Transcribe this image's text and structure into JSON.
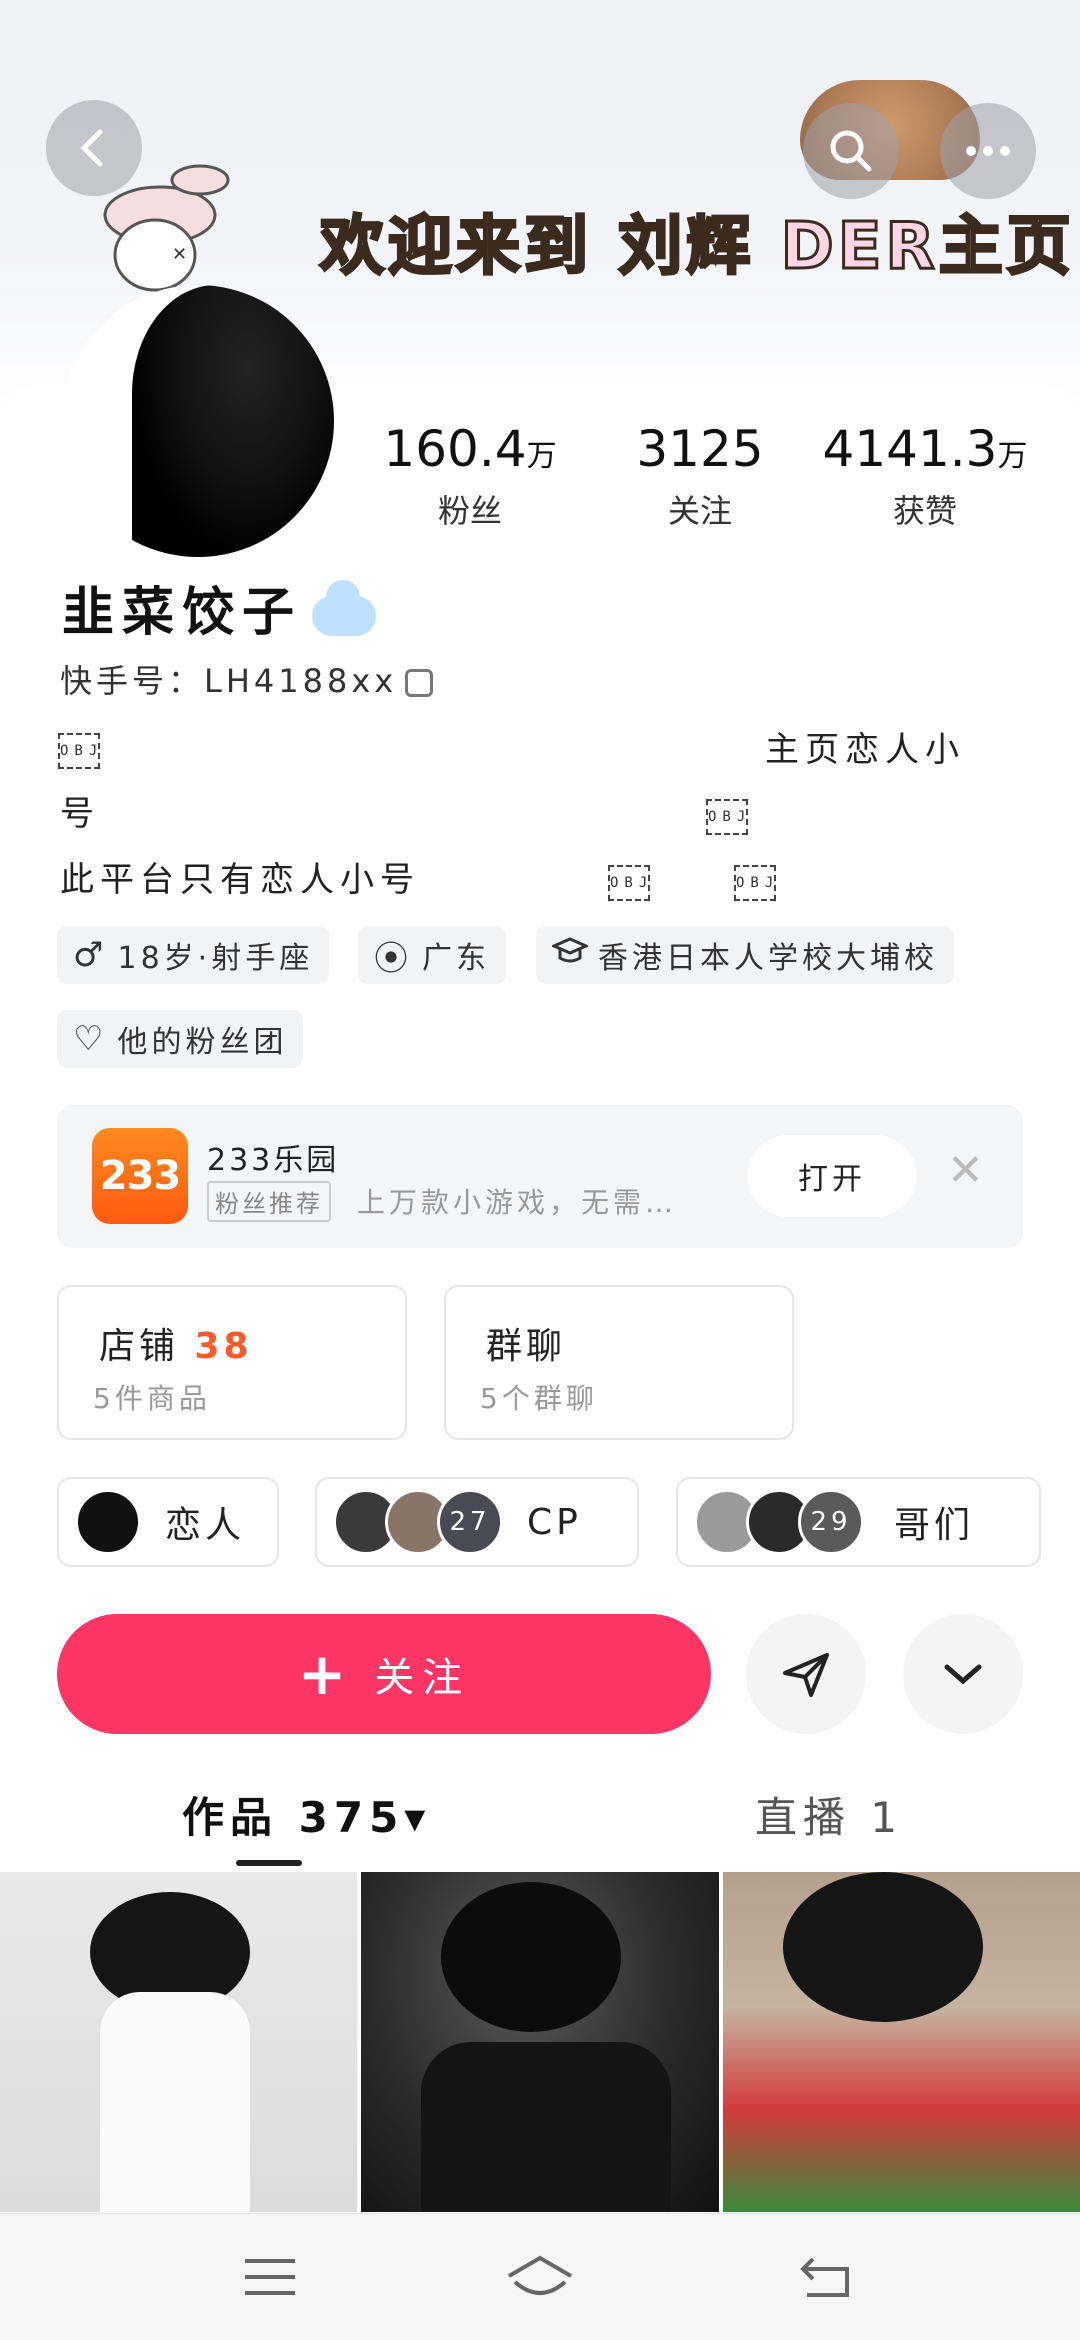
{
  "header": {
    "banner_prefix": "欢迎来到",
    "banner_name": "刘辉",
    "banner_der": "DER",
    "banner_suffix": "主页"
  },
  "profile": {
    "nickname": "韭菜饺子",
    "kuaishou_id": "快手号：LH4188xx",
    "stats": [
      {
        "value": "160.4",
        "unit": "万",
        "label": "粉丝"
      },
      {
        "value": "3125",
        "unit": "",
        "label": "关注"
      },
      {
        "value": "4141.3",
        "unit": "万",
        "label": "获赞"
      }
    ],
    "bio": {
      "line1_right": "主页恋人小",
      "line2": "号",
      "line3": "此平台只有恋人小号",
      "obj": "OBJ"
    },
    "tags": [
      {
        "icon": "♂",
        "label": "18岁·射手座"
      },
      {
        "icon": "⦿",
        "label": "广东"
      },
      {
        "icon": "🎓",
        "label": "香港日本人学校大埔校"
      },
      {
        "icon": "♡",
        "label": "他的粉丝团"
      }
    ]
  },
  "ad": {
    "logo_text": "233",
    "title": "233乐园",
    "badge": "粉丝推荐",
    "desc": "上万款小游戏，无需…",
    "open_label": "打开",
    "close_symbol": "✕"
  },
  "cards": [
    {
      "title": "店铺",
      "count": "38",
      "sub": "5件商品"
    },
    {
      "title": "群聊",
      "count": "",
      "sub": "5个群聊"
    }
  ],
  "relations": [
    {
      "label": "恋人",
      "count": ""
    },
    {
      "label": "CP",
      "count": "27"
    },
    {
      "label": "哥们",
      "count": "29"
    }
  ],
  "actions": {
    "follow_plus": "+",
    "follow_label": "关注",
    "share_icon": "➤",
    "more_icon": "⌄"
  },
  "tabs": {
    "works": "作品 375",
    "works_arrow": "▾",
    "live": "直播 1"
  },
  "colors": {
    "accent": "#fe3666",
    "shop_count": "#ff5a2a",
    "ad_logo": "#ff6a12"
  }
}
